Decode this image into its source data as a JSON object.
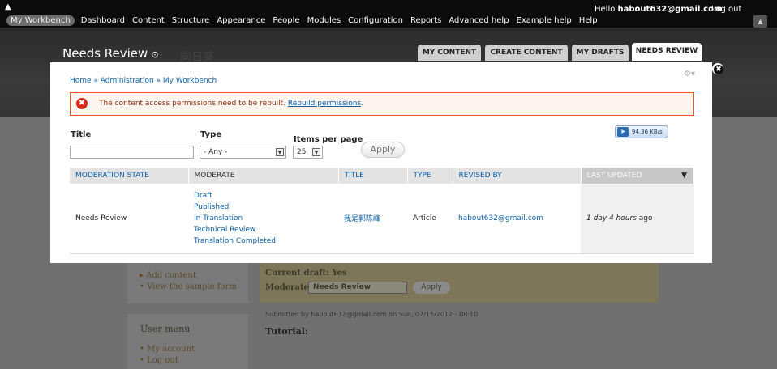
{
  "toolbar": {
    "home_icon": "home-icon",
    "items": [
      {
        "label": "My Workbench",
        "active": true
      },
      {
        "label": "Dashboard"
      },
      {
        "label": "Content"
      },
      {
        "label": "Structure"
      },
      {
        "label": "Appearance"
      },
      {
        "label": "People"
      },
      {
        "label": "Modules"
      },
      {
        "label": "Configuration"
      },
      {
        "label": "Reports"
      },
      {
        "label": "Advanced help"
      },
      {
        "label": "Example help"
      },
      {
        "label": "Help"
      }
    ],
    "greeting": "Hello ",
    "user": "habout632@gmail.com",
    "logout": "Log out"
  },
  "header": {
    "title": "Needs Review",
    "ghost_text": "向日葵",
    "tabs": [
      "MY CONTENT",
      "CREATE CONTENT",
      "MY DRAFTS",
      "NEEDS REVIEW"
    ],
    "active_tab": "NEEDS REVIEW"
  },
  "overlay": {
    "breadcrumb": "Home » Administration » My Workbench",
    "message_text": "The content access permissions need to be rebuilt. ",
    "message_link": "Rebuild permissions",
    "message_end": ".",
    "filters": {
      "title_label": "Title",
      "title_value": "",
      "type_label": "Type",
      "type_value": "- Any -",
      "ipp_label": "Items per page",
      "ipp_value": "25",
      "apply_label": "Apply"
    },
    "speed_badge": "94.36 KB/s",
    "table": {
      "headers": [
        "MODERATION STATE",
        "MODERATE",
        "TITLE",
        "TYPE",
        "REVISED BY",
        "LAST UPDATED"
      ],
      "row": {
        "state": "Needs Review",
        "moderate_links": [
          "Draft",
          "Published",
          "In Translation",
          "Technical Review",
          "Translation Completed"
        ],
        "title": "我是郭陈峰",
        "type": "Article",
        "revised_by": "habout632@gmail.com",
        "updated_em": "1 day 4 hours",
        "updated_rest": " ago"
      }
    }
  },
  "background": {
    "add_content": "Add content",
    "view_sample": "View the sample form",
    "user_menu": "User menu",
    "my_account": "My account",
    "log_out": "Log out",
    "current_draft": "Current draft: Yes",
    "moderate_label": "Moderate:",
    "moderate_value": "Needs Review",
    "apply": "Apply",
    "submitted": "Submitted by habout632@gmail.com on Sun, 07/15/2012 - 08:10",
    "tutorial": "Tutorial:"
  }
}
